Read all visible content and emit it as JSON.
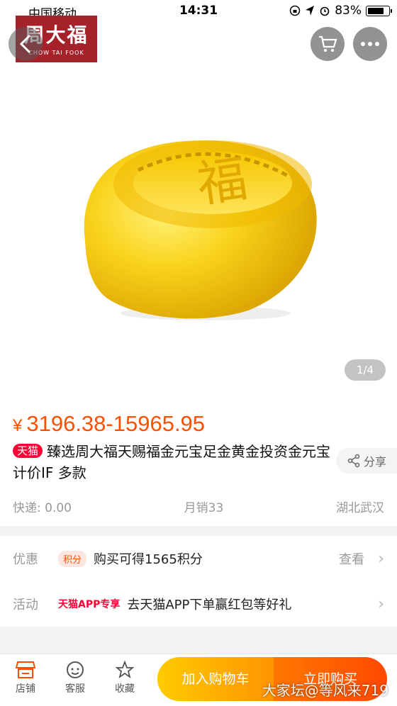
{
  "status": {
    "carrier": "中国移动",
    "time": "14:31",
    "battery": "83%",
    "battery_level": 0.83
  },
  "brand": {
    "name_cn": "周大福",
    "name_en": "CHOW TAI FOOK",
    "color": "#a6222a"
  },
  "gallery": {
    "page_indicator": "1/4",
    "current_page": 1,
    "total_pages": 4
  },
  "product": {
    "price_symbol": "¥",
    "price": "3196.38-15965.95",
    "badge": "天猫",
    "title": "臻选周大福天赐福金元宝足金黄金投资金元宝计价IF 多款",
    "share_label": "分享",
    "shipping": "快递: 0.00",
    "monthly_sales": "月销33",
    "location": "湖北武汉"
  },
  "promo": {
    "discount_label": "优惠",
    "points_tag": "积分",
    "points_text": "购买可得1565积分",
    "view_label": "查看",
    "activity_label": "活动",
    "app_tag": "天猫APP专享",
    "activity_text": "去天猫APP下单赢红包等好礼"
  },
  "bottom": {
    "store_label": "店铺",
    "service_label": "客服",
    "favorite_label": "收藏",
    "add_cart_label": "加入购物车",
    "buy_now_label": "立即购买"
  },
  "watermark": "大家坛@等风来719",
  "colors": {
    "price": "#ff5000",
    "tmall_red": "#ff0036",
    "cart_gradient": [
      "#ffcb00",
      "#ff9402"
    ],
    "buy_gradient": [
      "#ff7700",
      "#ff4900"
    ]
  },
  "icons": [
    "back-icon",
    "cart-icon",
    "more-icon",
    "share-icon",
    "store-icon",
    "service-icon",
    "star-icon",
    "chevron-right-icon"
  ]
}
